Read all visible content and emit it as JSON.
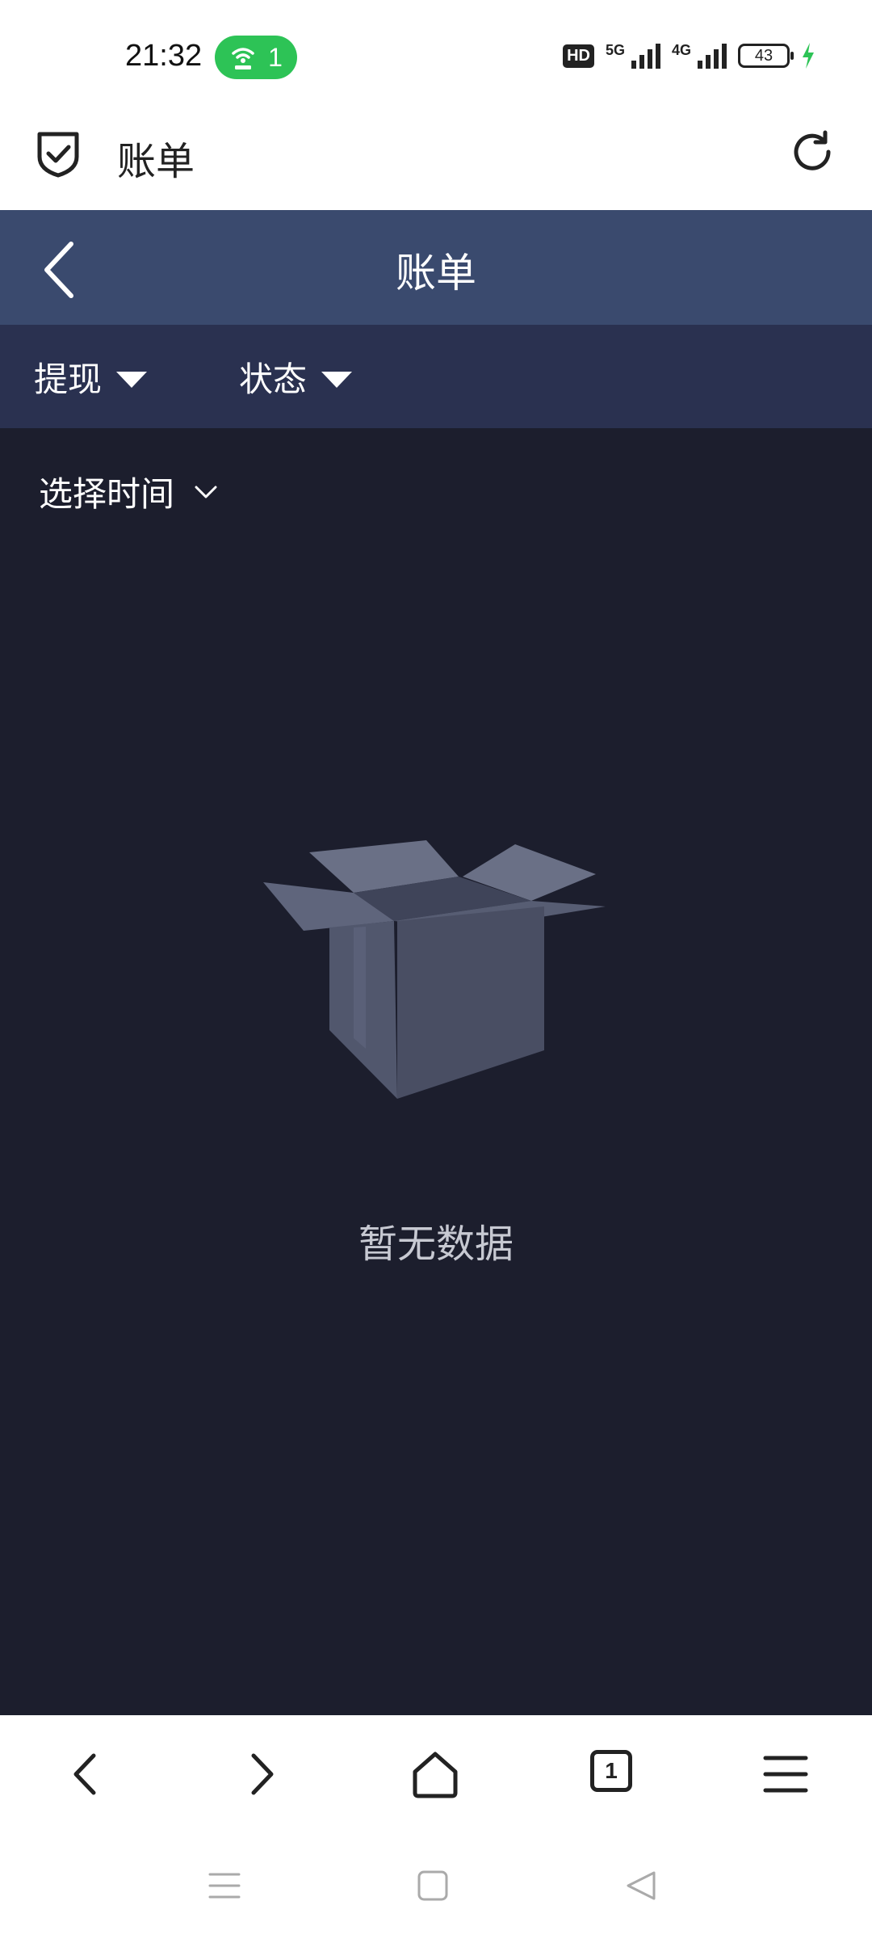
{
  "status_bar": {
    "time": "21:32",
    "hotspot_count": "1",
    "hd_label": "HD",
    "net1": "5G",
    "net2": "4G",
    "battery": "43",
    "hotspot_color": "#2dc356",
    "charging_color": "#2dc356"
  },
  "browser_header": {
    "title": "账单",
    "icons": [
      "shield-check-icon",
      "refresh-icon"
    ]
  },
  "app_header": {
    "title": "账单",
    "background": "#3a4a6e"
  },
  "filters": {
    "type_label": "提现",
    "status_label": "状态",
    "background": "#2a3150"
  },
  "content": {
    "time_select_label": "选择时间",
    "empty_text": "暂无数据",
    "background": "#1c1e2d"
  },
  "browser_bottom": {
    "tab_count": "1",
    "icons": [
      "back-icon",
      "forward-icon",
      "home-icon",
      "tabs-icon",
      "menu-icon"
    ]
  },
  "system_nav": {
    "icons": [
      "recent-apps-icon",
      "home-square-icon",
      "back-triangle-icon"
    ]
  }
}
